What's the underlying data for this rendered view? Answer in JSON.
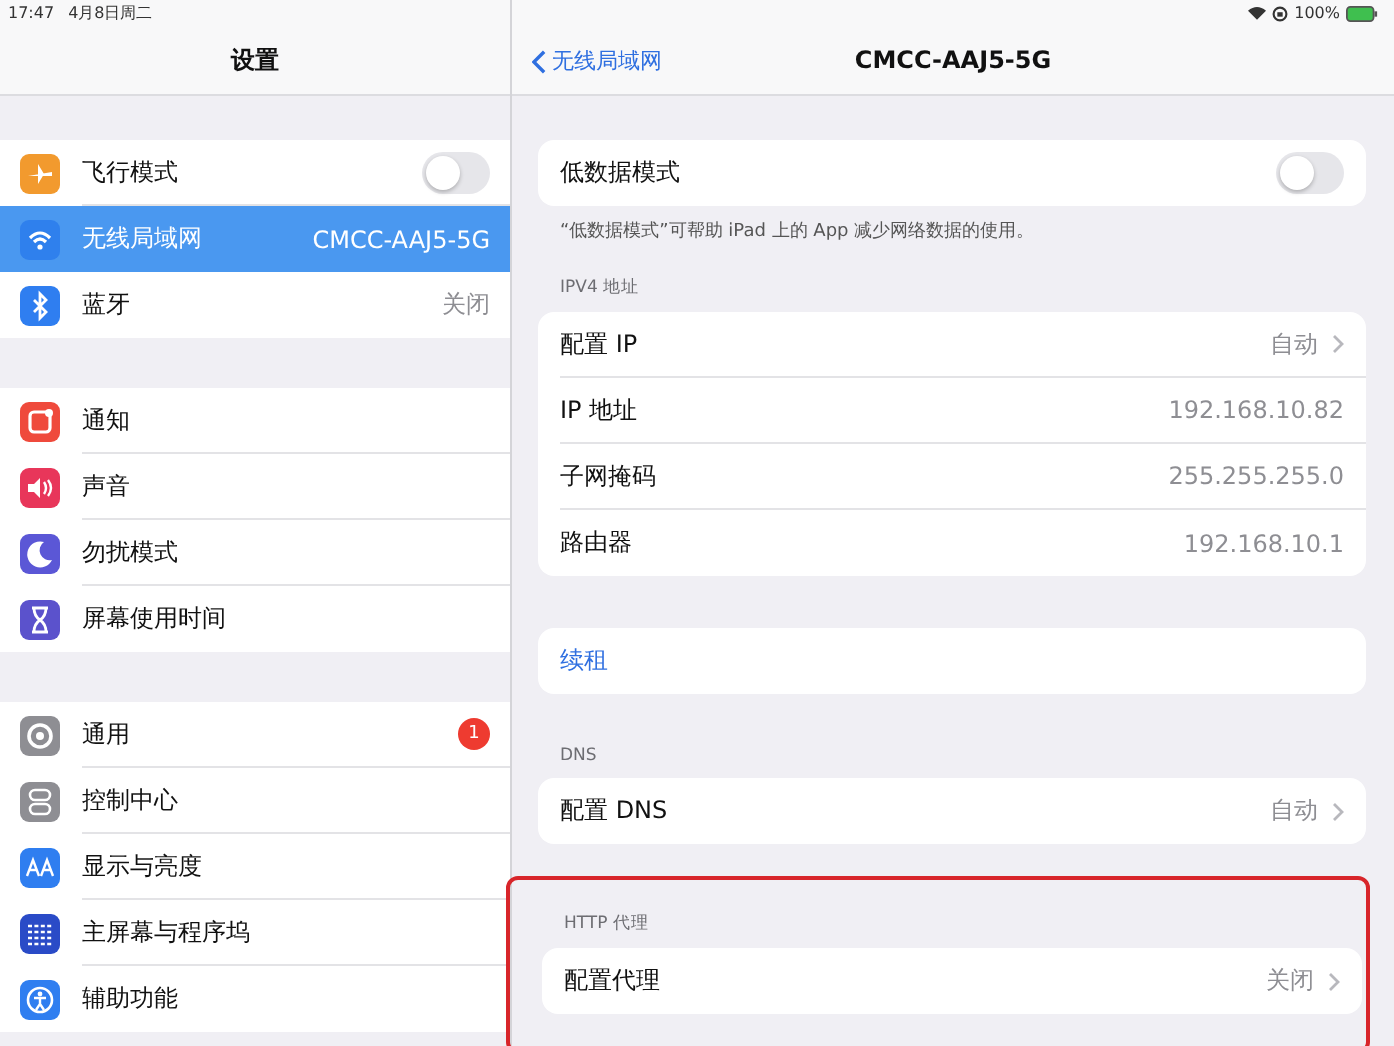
{
  "status_bar": {
    "time": "17:47",
    "date": "4月8日周二",
    "battery": "100%"
  },
  "sidebar": {
    "title": "设置",
    "groups": [
      {
        "items": [
          {
            "label": "飞行模式",
            "kind": "toggle",
            "on": false,
            "selected": false,
            "color": "#f29a2e"
          },
          {
            "label": "无线局域网",
            "kind": "value",
            "value": "CMCC-AAJ5-5G",
            "selected": true,
            "color": "#2f80ed"
          },
          {
            "label": "蓝牙",
            "kind": "value",
            "value": "关闭",
            "selected": false,
            "color": "#2f7ef0"
          }
        ]
      },
      {
        "items": [
          {
            "label": "通知",
            "kind": "plain",
            "selected": false,
            "color": "#ef4a3c"
          },
          {
            "label": "声音",
            "kind": "plain",
            "selected": false,
            "color": "#e8365a"
          },
          {
            "label": "勿扰模式",
            "kind": "plain",
            "selected": false,
            "color": "#5b57d6"
          },
          {
            "label": "屏幕使用时间",
            "kind": "plain",
            "selected": false,
            "color": "#5b52cc"
          }
        ]
      },
      {
        "items": [
          {
            "label": "通用",
            "kind": "badge",
            "badge": "1",
            "selected": false,
            "color": "#8e8e93"
          },
          {
            "label": "控制中心",
            "kind": "plain",
            "selected": false,
            "color": "#8e8e93"
          },
          {
            "label": "显示与亮度",
            "kind": "plain",
            "selected": false,
            "color": "#2f7ef0"
          },
          {
            "label": "主屏幕与程序坞",
            "kind": "plain",
            "selected": false,
            "color": "#2a4bc7"
          },
          {
            "label": "辅助功能",
            "kind": "plain",
            "selected": false,
            "color": "#2f7ef0"
          }
        ]
      }
    ]
  },
  "detail": {
    "back": "无线局域网",
    "title": "CMCC-AAJ5-5G",
    "sections": [
      {
        "rows": [
          {
            "label": "低数据模式",
            "kind": "toggle",
            "on": false
          }
        ],
        "footer": "“低数据模式”可帮助 iPad 上的 App 减少网络数据的使用。",
        "highlighted": false
      },
      {
        "header": "IPV4 地址",
        "rows": [
          {
            "label": "配置 IP",
            "kind": "nav",
            "value": "自动"
          },
          {
            "label": "IP 地址",
            "kind": "info",
            "value": "192.168.10.82"
          },
          {
            "label": "子网掩码",
            "kind": "info",
            "value": "255.255.255.0"
          },
          {
            "label": "路由器",
            "kind": "info",
            "value": "192.168.10.1"
          }
        ],
        "highlighted": false
      },
      {
        "rows": [
          {
            "label": "续租",
            "kind": "link"
          }
        ],
        "highlighted": false
      },
      {
        "header": "DNS",
        "rows": [
          {
            "label": "配置 DNS",
            "kind": "nav",
            "value": "自动"
          }
        ],
        "highlighted": false
      },
      {
        "header": "HTTP 代理",
        "rows": [
          {
            "label": "配置代理",
            "kind": "nav",
            "value": "关闭"
          }
        ],
        "highlighted": true
      }
    ]
  }
}
